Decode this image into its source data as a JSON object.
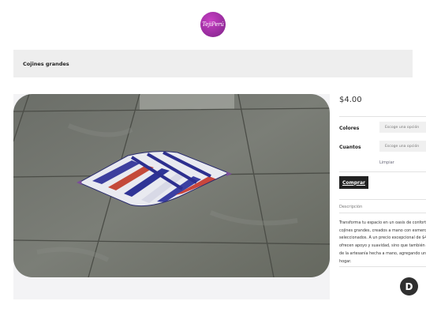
{
  "header": {
    "logo_text": "TejiPerú"
  },
  "page": {
    "title": "Cojines grandes"
  },
  "product": {
    "price": "$4.00",
    "options": [
      {
        "label": "Colores",
        "placeholder": "Escoge una opción"
      },
      {
        "label": "Cuantos",
        "placeholder": "Escoge una opción"
      }
    ],
    "clear_label": "Limpiar",
    "buy_label": "Comprar",
    "description_tab": "Descripción",
    "description_lines": [
      "Transforma tu espacio en un oasis de confort",
      "cojines grandes, creados a mano con esmero",
      "seleccionados. A un precio excepcional de $4",
      "ofrecen apoyo y suavidad, sino que también",
      "de la artesanía hecha a mano, agregando un",
      "hogar."
    ]
  },
  "widget": {
    "badge_letter": "D"
  },
  "colors": {
    "brand": "#9b2ea0",
    "button": "#222222",
    "title_bar": "#eeeeee"
  }
}
